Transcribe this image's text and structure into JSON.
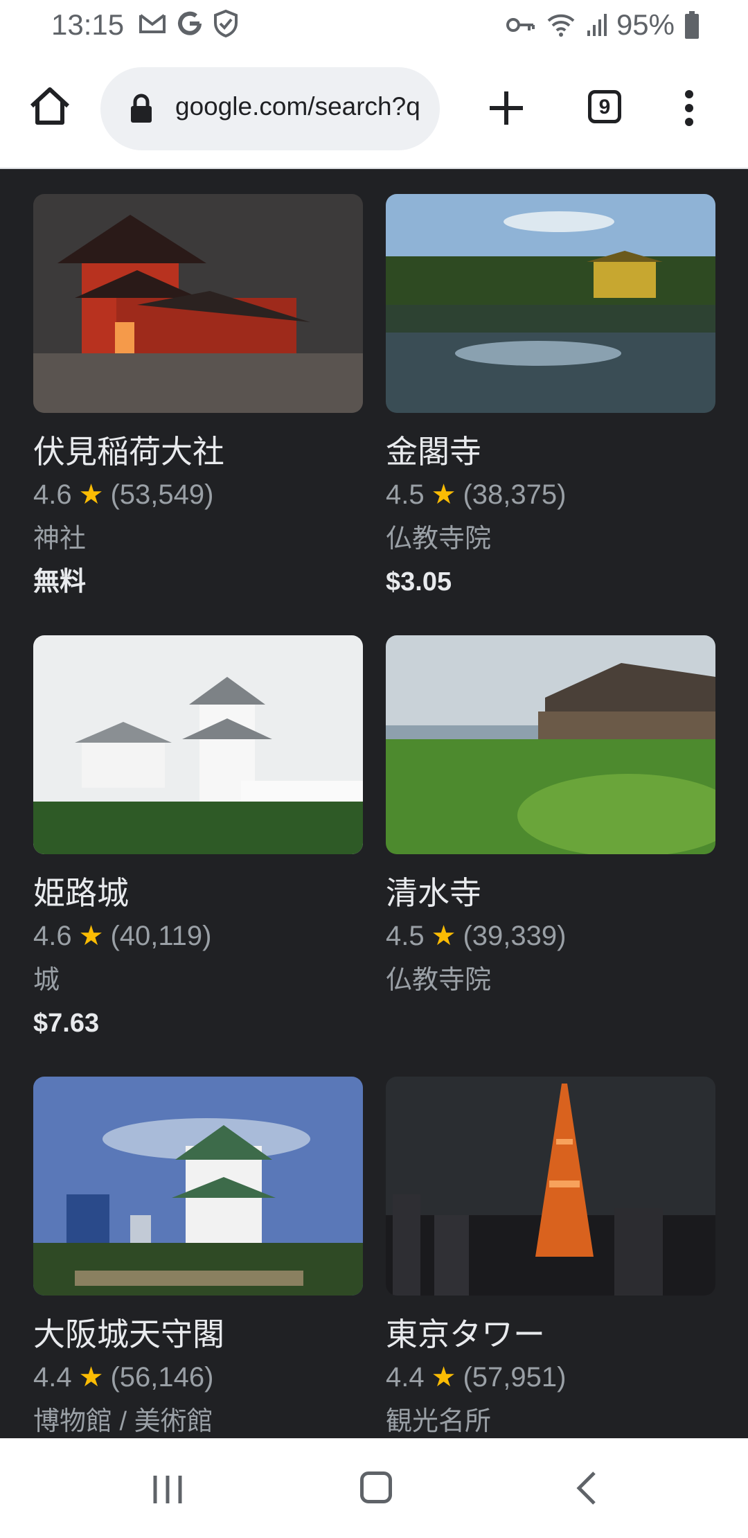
{
  "status_bar": {
    "time": "13:15",
    "left_icons": [
      "gmail-icon",
      "google-icon",
      "shield-check-icon"
    ],
    "right_icons": [
      "vpn-key-icon",
      "wifi-icon",
      "signal-icon"
    ],
    "battery_percent": "95%",
    "battery_icon": "battery-icon"
  },
  "toolbar": {
    "url": "google.com/search?q",
    "tab_count": "9"
  },
  "places": [
    {
      "name": "伏見稲荷大社",
      "rating": "4.6",
      "reviews": "(53,549)",
      "category": "神社",
      "price": "無料"
    },
    {
      "name": "金閣寺",
      "rating": "4.5",
      "reviews": "(38,375)",
      "category": "仏教寺院",
      "price": "$3.05"
    },
    {
      "name": "姫路城",
      "rating": "4.6",
      "reviews": "(40,119)",
      "category": "城",
      "price": "$7.63"
    },
    {
      "name": "清水寺",
      "rating": "4.5",
      "reviews": "(39,339)",
      "category": "仏教寺院",
      "price": ""
    },
    {
      "name": "大阪城天守閣",
      "rating": "4.4",
      "reviews": "(56,146)",
      "category": "博物館 / 美術館",
      "price": ""
    },
    {
      "name": "東京タワー",
      "rating": "4.4",
      "reviews": "(57,951)",
      "category": "観光名所",
      "price": ""
    }
  ],
  "colors": {
    "background": "#202124",
    "star": "#fbbc04"
  }
}
